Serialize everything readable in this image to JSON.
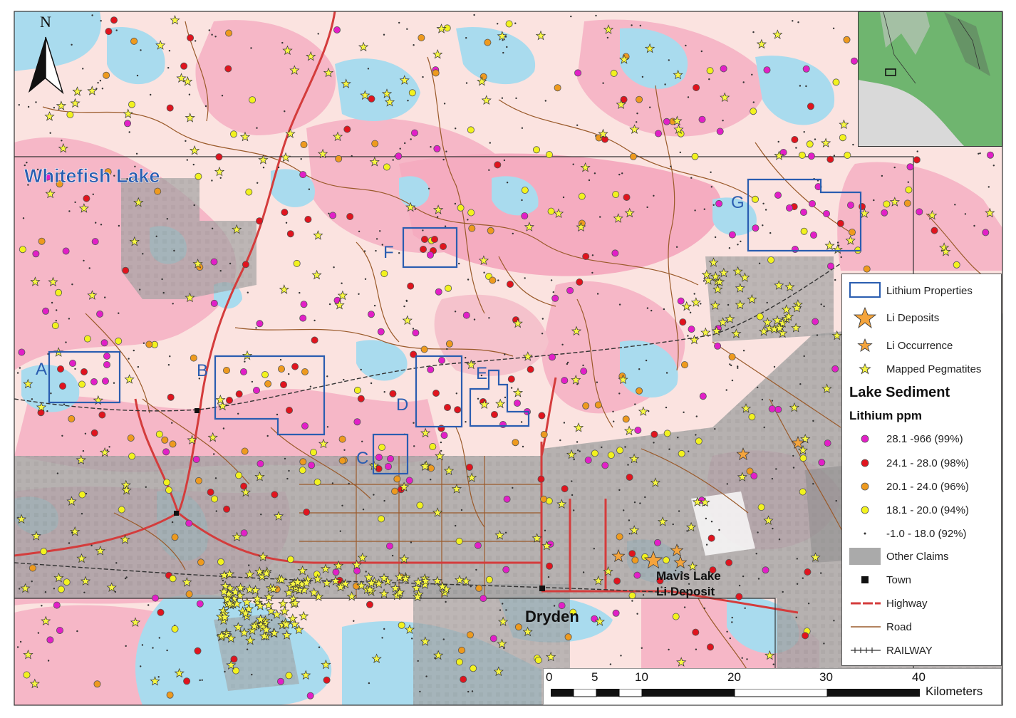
{
  "map": {
    "north_label": "N",
    "place_labels": {
      "whitefish_lake": "Whitefish Lake",
      "dryden": "Dryden",
      "mavis_lake": "Mavis Lake",
      "li_deposit": "Li Deposit"
    },
    "properties": [
      "A",
      "B",
      "C",
      "D",
      "E",
      "F",
      "G"
    ],
    "colors": {
      "property_outline": "#2a5db0",
      "lake": "#a9dbee",
      "pink_geology": "#f5b6c6",
      "light_pink": "#fbe0e0",
      "claims": "#9c9c9c",
      "highway": "#d43c3c",
      "road": "#9a5a2a",
      "railway": "#333333",
      "sample_high": "#e21fc7",
      "sample_red": "#e0141e",
      "sample_orange": "#ee9a1e",
      "sample_yellow": "#f2f21e",
      "pegmatite": "#f7f742",
      "li_deposit": "#f4a43c"
    }
  },
  "legend": {
    "items": [
      {
        "label": "Lithium Properties",
        "symbol": "property-box"
      },
      {
        "label": "Li Deposits",
        "symbol": "large-orange-star"
      },
      {
        "label": "Li Occurrence",
        "symbol": "small-orange-star"
      },
      {
        "label": "Mapped Pegmatites",
        "symbol": "yellow-star"
      }
    ],
    "heading": "Lake Sediment",
    "subheading": "Lithium ppm",
    "classes": [
      {
        "label": "28.1 -966 (99%)",
        "color": "#e21fc7"
      },
      {
        "label": "24.1 - 28.0 (98%)",
        "color": "#e0141e"
      },
      {
        "label": "20.1 - 24.0 (96%)",
        "color": "#ee9a1e"
      },
      {
        "label": "18.1 - 20.0 (94%)",
        "color": "#f2f21e"
      },
      {
        "label": "-1.0 - 18.0 (92%)",
        "color": "#333333"
      }
    ],
    "other_items": [
      {
        "label": "Other Claims",
        "symbol": "grey-box"
      },
      {
        "label": "Town",
        "symbol": "black-square"
      },
      {
        "label": "Highway",
        "symbol": "red-dashed-line"
      },
      {
        "label": "Road",
        "symbol": "brown-line"
      },
      {
        "label": "RAILWAY",
        "symbol": "railway-line"
      }
    ]
  },
  "scale_bar": {
    "ticks": [
      "0",
      "5",
      "10",
      "20",
      "30",
      "40"
    ],
    "unit": "Kilometers"
  }
}
